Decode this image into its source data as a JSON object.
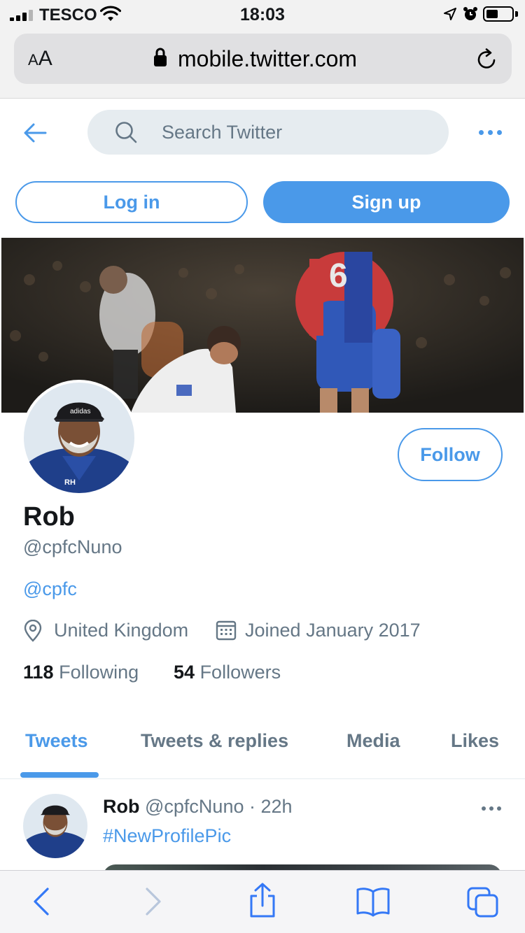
{
  "status_bar": {
    "carrier": "TESCO",
    "time": "18:03",
    "icons": [
      "signal-bars-icon",
      "wifi-icon",
      "location-arrow-icon",
      "alarm-icon",
      "battery-icon"
    ]
  },
  "browser": {
    "text_size_label_small": "A",
    "text_size_label_large": "A",
    "url": "mobile.twitter.com",
    "icons": [
      "lock-icon",
      "reload-icon"
    ]
  },
  "header": {
    "search_placeholder": "Search Twitter",
    "login_label": "Log in",
    "signup_label": "Sign up"
  },
  "profile": {
    "follow_label": "Follow",
    "name": "Rob",
    "handle": "@cpfcNuno",
    "bio_link": "@cpfc",
    "location": "United Kingdom",
    "joined": "Joined January 2017",
    "following_count": "118",
    "following_label": "Following",
    "followers_count": "54",
    "followers_label": "Followers"
  },
  "tabs": [
    {
      "label": "Tweets",
      "active": true
    },
    {
      "label": "Tweets & replies",
      "active": false
    },
    {
      "label": "Media",
      "active": false
    },
    {
      "label": "Likes",
      "active": false
    }
  ],
  "tweet": {
    "author": "Rob",
    "handle": "@cpfcNuno",
    "separator": "·",
    "time": "22h",
    "text": "#NewProfilePic"
  },
  "colors": {
    "accent": "#4a99e9",
    "secondary_text": "#657786",
    "primary_text": "#14171a",
    "search_bg": "#e6ecf0"
  }
}
